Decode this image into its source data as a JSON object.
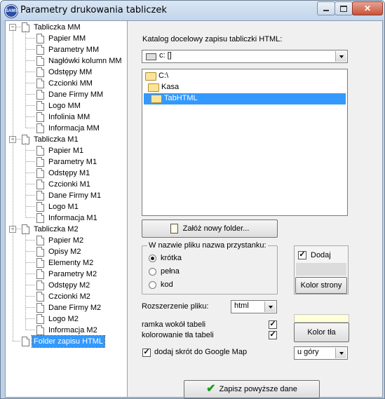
{
  "window": {
    "title": "Parametry drukowania tabliczek",
    "app_icon_text": "SAMSON"
  },
  "tree": {
    "groups": [
      {
        "label": "Tabliczka MM",
        "children": [
          "Papier MM",
          "Parametry MM",
          "Nagłówki kolumn MM",
          "Odstępy MM",
          "Czcionki MM",
          "Dane Firmy MM",
          "Logo MM",
          "Infolinia MM",
          "Informacja MM"
        ]
      },
      {
        "label": "Tabliczka M1",
        "children": [
          "Papier M1",
          "Parametry M1",
          "Odstępy M1",
          "Czcionki M1",
          "Dane Firmy M1",
          "Logo M1",
          "Informacja M1"
        ]
      },
      {
        "label": "Tabliczka M2",
        "children": [
          "Papier M2",
          "Opisy M2",
          "Elementy M2",
          "Parametry M2",
          "Odstępy M2",
          "Czcionki M2",
          "Dane Firmy M2",
          "Logo M2",
          "Informacja M2"
        ]
      }
    ],
    "selected_item": "Folder zapisu HTML"
  },
  "form": {
    "catalog_label": "Katalog docelowy zapisu tabliczki HTML:",
    "drive_value": "c: []",
    "folders": [
      "C:\\",
      "Kasa",
      "TabHTML"
    ],
    "selected_folder": "TabHTML",
    "new_folder_button": "Załóż nowy folder...",
    "name_group": {
      "label": "W nazwie pliku nazwa przystanku:",
      "options": [
        "krótka",
        "pełna",
        "kod"
      ],
      "selected": "krótka"
    },
    "add_checkbox_label": "Dodaj",
    "add_checked": true,
    "page_color_button": "Kolor strony",
    "extension_label": "Rozszerzenie pliku:",
    "extension_value": "html",
    "frame_label": "ramka wokół tabeli",
    "frame_checked": true,
    "bg_color_label": "kolorowanie tła tabeli",
    "bg_color_checked": true,
    "bg_color_button": "Kolor tła",
    "google_label": "dodaj skrót do Google Map",
    "google_checked": true,
    "google_position": "u góry",
    "save_button": "Zapisz powyższe dane",
    "colors": {
      "page_color_swatch": "#dcdcdc",
      "bg_color_swatch": "#ffffd8",
      "selection": "#3399ff"
    }
  }
}
